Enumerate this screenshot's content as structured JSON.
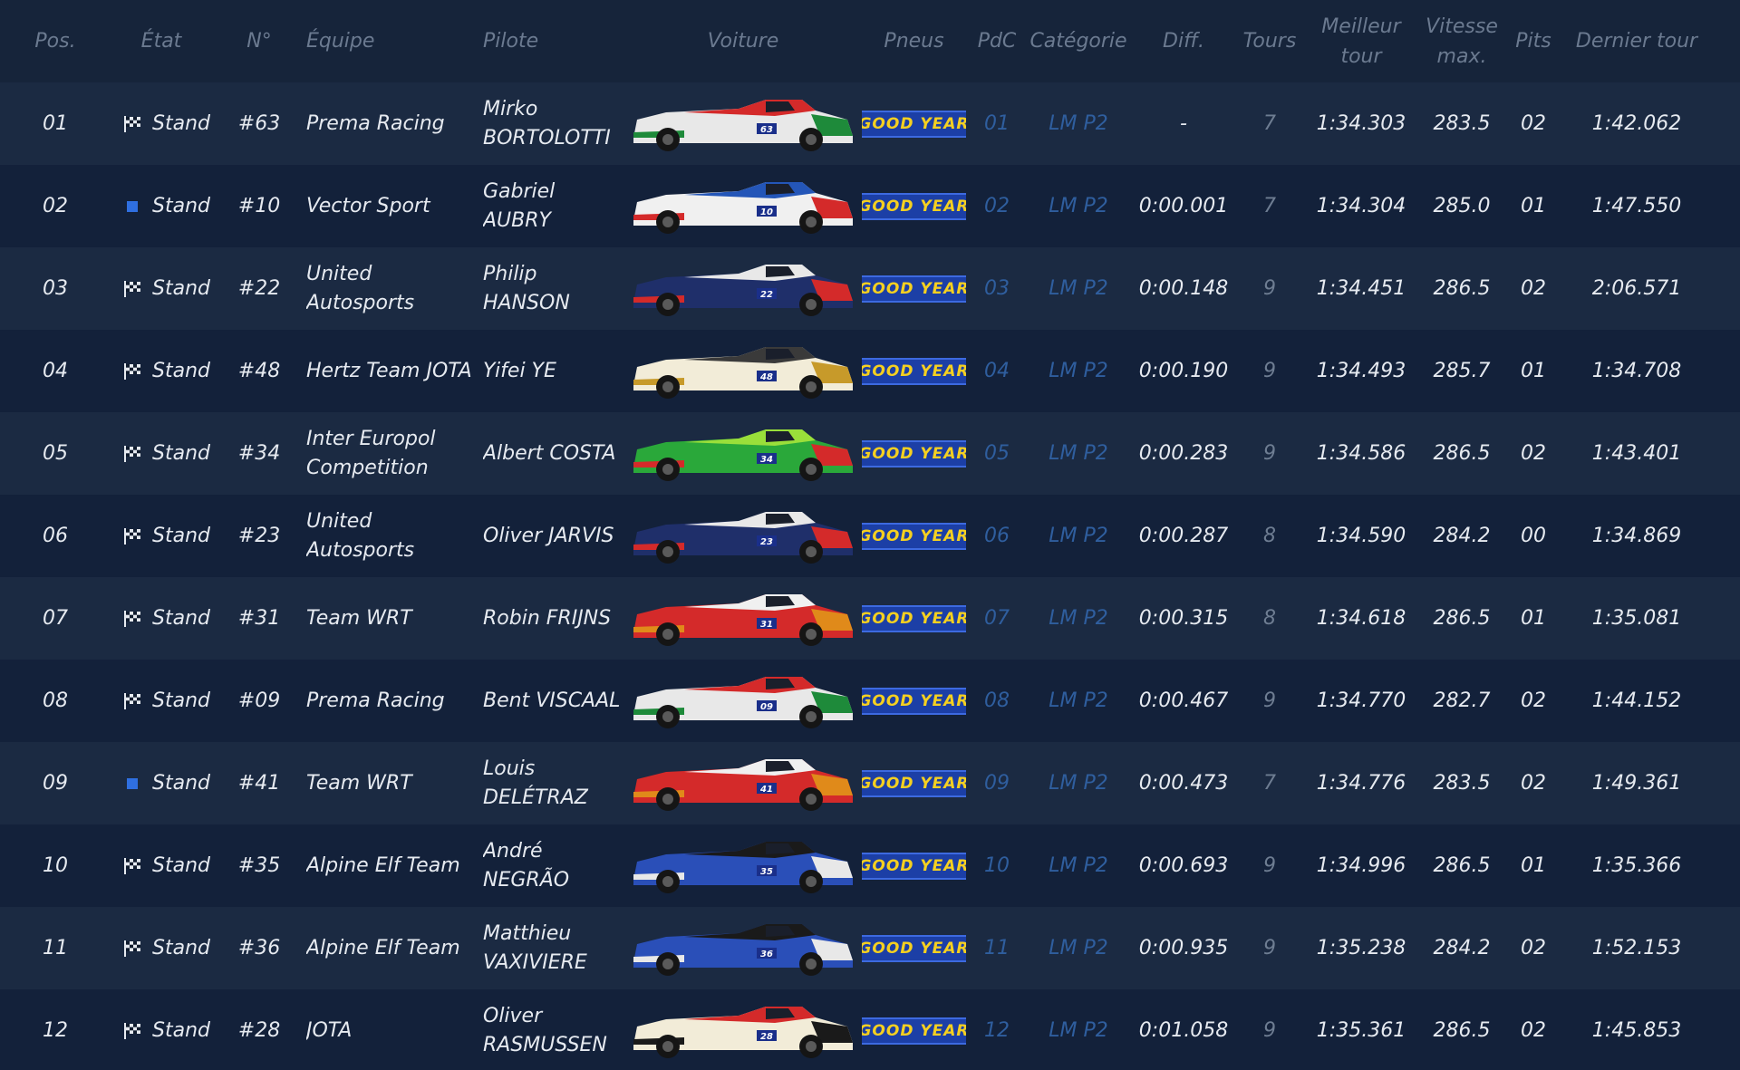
{
  "headers": {
    "pos": "Pos.",
    "etat": "État",
    "num": "N°",
    "team": "Équipe",
    "driver": "Pilote",
    "car": "Voiture",
    "tyres": "Pneus",
    "pdc": "PdC",
    "category": "Catégorie",
    "diff": "Diff.",
    "laps": "Tours",
    "best_lap": "Meilleur tour",
    "top_speed": "Vitesse max.",
    "pits": "Pits",
    "last_lap": "Dernier tour"
  },
  "colors": {
    "background": "#0f1b2d",
    "row_odd": "#1b2a42",
    "row_even": "#13213a",
    "text": "#e6eaf0",
    "muted_text": "#6e7d92",
    "class_text": "#2f5e9e",
    "goodyear_blue": "#1c3fa6",
    "goodyear_yellow": "#f5d020",
    "status_blue": "#2f6fe0"
  },
  "rows": [
    {
      "pos": "01",
      "status_icon": "checkered-flag-icon",
      "status": "Stand",
      "number": "#63",
      "team": "Prema Racing",
      "driver": "Mirko BORTOLOTTI",
      "car_livery": [
        "#e8e8e8",
        "#d42a2a",
        "#1e8a3a"
      ],
      "tyre_brand": "GOOD YEAR",
      "pdc": "01",
      "category": "LM P2",
      "diff": "-",
      "laps": "7",
      "best_lap": "1:34.303",
      "top_speed": "283.5",
      "pits": "02",
      "last_lap": "1:42.062"
    },
    {
      "pos": "02",
      "status_icon": "blue-square-icon",
      "status": "Stand",
      "number": "#10",
      "team": "Vector Sport",
      "driver": "Gabriel AUBRY",
      "car_livery": [
        "#f0f0f0",
        "#2456b8",
        "#d42a2a"
      ],
      "tyre_brand": "GOOD YEAR",
      "pdc": "02",
      "category": "LM P2",
      "diff": "0:00.001",
      "laps": "7",
      "best_lap": "1:34.304",
      "top_speed": "285.0",
      "pits": "01",
      "last_lap": "1:47.550"
    },
    {
      "pos": "03",
      "status_icon": "checkered-flag-icon",
      "status": "Stand",
      "number": "#22",
      "team": "United Autosports",
      "driver": "Philip HANSON",
      "car_livery": [
        "#1f2f6a",
        "#e8e8e8",
        "#d42a2a"
      ],
      "tyre_brand": "GOOD YEAR",
      "pdc": "03",
      "category": "LM P2",
      "diff": "0:00.148",
      "laps": "9",
      "best_lap": "1:34.451",
      "top_speed": "286.5",
      "pits": "02",
      "last_lap": "2:06.571"
    },
    {
      "pos": "04",
      "status_icon": "checkered-flag-icon",
      "status": "Stand",
      "number": "#48",
      "team": "Hertz Team JOTA",
      "driver": "Yifei YE",
      "car_livery": [
        "#f2ecd8",
        "#3a3a3a",
        "#c79a2a"
      ],
      "tyre_brand": "GOOD YEAR",
      "pdc": "04",
      "category": "LM P2",
      "diff": "0:00.190",
      "laps": "9",
      "best_lap": "1:34.493",
      "top_speed": "285.7",
      "pits": "01",
      "last_lap": "1:34.708"
    },
    {
      "pos": "05",
      "status_icon": "checkered-flag-icon",
      "status": "Stand",
      "number": "#34",
      "team": "Inter Europol Competition",
      "driver": "Albert COSTA",
      "car_livery": [
        "#2aa83a",
        "#9adf3a",
        "#d42a2a"
      ],
      "tyre_brand": "GOOD YEAR",
      "pdc": "05",
      "category": "LM P2",
      "diff": "0:00.283",
      "laps": "9",
      "best_lap": "1:34.586",
      "top_speed": "286.5",
      "pits": "02",
      "last_lap": "1:43.401"
    },
    {
      "pos": "06",
      "status_icon": "checkered-flag-icon",
      "status": "Stand",
      "number": "#23",
      "team": "United Autosports",
      "driver": "Oliver JARVIS",
      "car_livery": [
        "#1f2f6a",
        "#e8e8e8",
        "#d42a2a"
      ],
      "tyre_brand": "GOOD YEAR",
      "pdc": "06",
      "category": "LM P2",
      "diff": "0:00.287",
      "laps": "8",
      "best_lap": "1:34.590",
      "top_speed": "284.2",
      "pits": "00",
      "last_lap": "1:34.869"
    },
    {
      "pos": "07",
      "status_icon": "checkered-flag-icon",
      "status": "Stand",
      "number": "#31",
      "team": "Team WRT",
      "driver": "Robin FRIJNS",
      "car_livery": [
        "#d42a2a",
        "#f0f0f0",
        "#e08a1a"
      ],
      "tyre_brand": "GOOD YEAR",
      "pdc": "07",
      "category": "LM P2",
      "diff": "0:00.315",
      "laps": "8",
      "best_lap": "1:34.618",
      "top_speed": "286.5",
      "pits": "01",
      "last_lap": "1:35.081"
    },
    {
      "pos": "08",
      "status_icon": "checkered-flag-icon",
      "status": "Stand",
      "number": "#09",
      "team": "Prema Racing",
      "driver": "Bent VISCAAL",
      "car_livery": [
        "#e8e8e8",
        "#d42a2a",
        "#1e8a3a"
      ],
      "tyre_brand": "GOOD YEAR",
      "pdc": "08",
      "category": "LM P2",
      "diff": "0:00.467",
      "laps": "9",
      "best_lap": "1:34.770",
      "top_speed": "282.7",
      "pits": "02",
      "last_lap": "1:44.152"
    },
    {
      "pos": "09",
      "status_icon": "blue-square-icon",
      "status": "Stand",
      "number": "#41",
      "team": "Team WRT",
      "driver": "Louis DELÉTRAZ",
      "car_livery": [
        "#d42a2a",
        "#f0f0f0",
        "#e08a1a"
      ],
      "tyre_brand": "GOOD YEAR",
      "pdc": "09",
      "category": "LM P2",
      "diff": "0:00.473",
      "laps": "7",
      "best_lap": "1:34.776",
      "top_speed": "283.5",
      "pits": "02",
      "last_lap": "1:49.361"
    },
    {
      "pos": "10",
      "status_icon": "checkered-flag-icon",
      "status": "Stand",
      "number": "#35",
      "team": "Alpine Elf Team",
      "driver": "André NEGRÃO",
      "car_livery": [
        "#2a4fb8",
        "#1a1a1a",
        "#e8e8e8"
      ],
      "tyre_brand": "GOOD YEAR",
      "pdc": "10",
      "category": "LM P2",
      "diff": "0:00.693",
      "laps": "9",
      "best_lap": "1:34.996",
      "top_speed": "286.5",
      "pits": "01",
      "last_lap": "1:35.366"
    },
    {
      "pos": "11",
      "status_icon": "checkered-flag-icon",
      "status": "Stand",
      "number": "#36",
      "team": "Alpine Elf Team",
      "driver": "Matthieu VAXIVIERE",
      "car_livery": [
        "#2a4fb8",
        "#1a1a1a",
        "#e8e8e8"
      ],
      "tyre_brand": "GOOD YEAR",
      "pdc": "11",
      "category": "LM P2",
      "diff": "0:00.935",
      "laps": "9",
      "best_lap": "1:35.238",
      "top_speed": "284.2",
      "pits": "02",
      "last_lap": "1:52.153"
    },
    {
      "pos": "12",
      "status_icon": "checkered-flag-icon",
      "status": "Stand",
      "number": "#28",
      "team": "JOTA",
      "driver": "Oliver RASMUSSEN",
      "car_livery": [
        "#f2ecd8",
        "#d42a2a",
        "#1a1a1a"
      ],
      "tyre_brand": "GOOD YEAR",
      "pdc": "12",
      "category": "LM P2",
      "diff": "0:01.058",
      "laps": "9",
      "best_lap": "1:35.361",
      "top_speed": "286.5",
      "pits": "02",
      "last_lap": "1:45.853"
    }
  ]
}
